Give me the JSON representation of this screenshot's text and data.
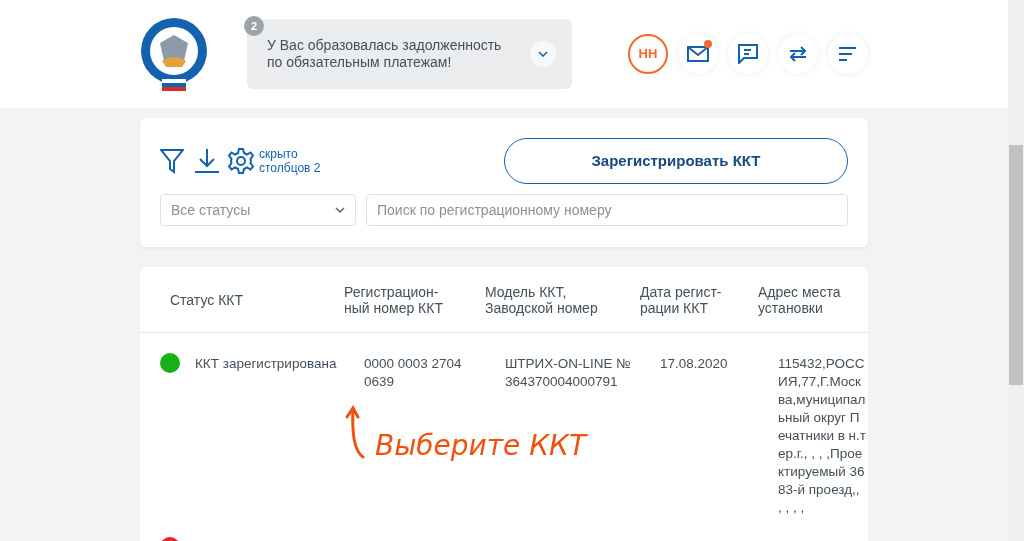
{
  "header": {
    "notification": {
      "count": "2",
      "text": "У Вас образовалась задолженность по обязательным платежам!"
    },
    "avatar": "НН",
    "mail_unread": true
  },
  "toolbar": {
    "hidden_columns": "скрыто столбцов 2",
    "register_button": "Зарегистрировать ККТ",
    "status_filter": {
      "value": "Все статусы"
    },
    "search": {
      "placeholder": "Поиск по регистрационному номеру"
    }
  },
  "table": {
    "columns": [
      "Статус ККТ",
      "Регистрацион-ный номер ККТ",
      "Модель ККТ, Заводской номер",
      "Дата регист-рации ККТ",
      "Адрес места установки"
    ],
    "rows": [
      {
        "color": "#19b01a",
        "status": "ККТ зарегистрирована",
        "reg_number": "0000 0003 2704 0639",
        "model": "ШТРИХ-ON-LINE № 364370004000791",
        "date": "17.08.2020",
        "address": "115432,РОССИЯ,77,Г.Москва,муниципальный округ Печатники в н.тер.г., , , ,Проектируемый 3683-й проезд,, , , , ,"
      },
      {
        "color": "#e8262a"
      }
    ]
  },
  "annotation": "Выберите ККТ"
}
